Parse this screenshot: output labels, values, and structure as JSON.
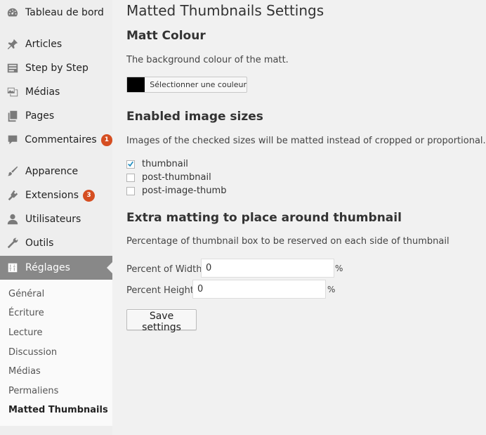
{
  "sidebar": {
    "items": [
      {
        "label": "Tableau de bord",
        "icon": "dashboard-icon"
      },
      {
        "label": "Articles",
        "icon": "pin-icon"
      },
      {
        "label": "Step by Step",
        "icon": "list-icon"
      },
      {
        "label": "Médias",
        "icon": "media-icon"
      },
      {
        "label": "Pages",
        "icon": "pages-icon"
      },
      {
        "label": "Commentaires",
        "icon": "comment-icon",
        "badge": "1"
      },
      {
        "label": "Apparence",
        "icon": "brush-icon"
      },
      {
        "label": "Extensions",
        "icon": "plugin-icon",
        "badge": "3"
      },
      {
        "label": "Utilisateurs",
        "icon": "user-icon"
      },
      {
        "label": "Outils",
        "icon": "wrench-icon"
      },
      {
        "label": "Réglages",
        "icon": "settings-icon"
      }
    ],
    "submenu": [
      {
        "label": "Général"
      },
      {
        "label": "Écriture"
      },
      {
        "label": "Lecture"
      },
      {
        "label": "Discussion"
      },
      {
        "label": "Médias"
      },
      {
        "label": "Permaliens"
      },
      {
        "label": "Matted Thumbnails"
      }
    ]
  },
  "main": {
    "title": "Matted Thumbnails Settings",
    "matt_colour": {
      "heading": "Matt Colour",
      "description": "The background colour of the matt.",
      "swatch_color": "#000000",
      "picker_label": "Sélectionner une couleur"
    },
    "image_sizes": {
      "heading": "Enabled image sizes",
      "description": "Images of the checked sizes will be matted instead of cropped or proportional.",
      "options": [
        {
          "label": "thumbnail",
          "checked": true
        },
        {
          "label": "post-thumbnail",
          "checked": false
        },
        {
          "label": "post-image-thumb",
          "checked": false
        }
      ]
    },
    "extra_matting": {
      "heading": "Extra matting to place around thumbnail",
      "description": "Percentage of thumbnail box to be reserved on each side of thumbnail",
      "width_label": "Percent of Width",
      "width_value": "0",
      "height_label": "Percent Height",
      "height_value": "0",
      "unit": "%"
    },
    "save_label": "Save settings"
  },
  "colors": {
    "current_menu_bg": "#888888",
    "badge": "#d54e21"
  }
}
